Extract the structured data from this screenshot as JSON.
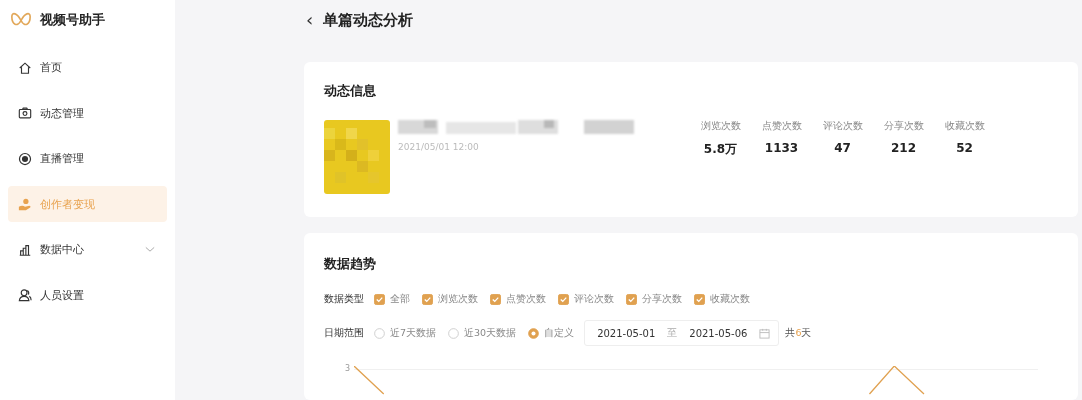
{
  "app": {
    "name": "视频号助手"
  },
  "sidebar": {
    "items": [
      {
        "label": "首页",
        "selected": false,
        "expandable": false
      },
      {
        "label": "动态管理",
        "selected": false,
        "expandable": false
      },
      {
        "label": "直播管理",
        "selected": false,
        "expandable": false
      },
      {
        "label": "创作者变现",
        "selected": true,
        "expandable": false
      },
      {
        "label": "数据中心",
        "selected": false,
        "expandable": true
      },
      {
        "label": "人员设置",
        "selected": false,
        "expandable": false
      }
    ]
  },
  "header": {
    "back": "‹",
    "title": "单篇动态分析"
  },
  "post_info": {
    "title": "动态信息",
    "time": "2021/05/01 12:00",
    "stats": [
      {
        "label": "浏览次数",
        "value": "5.8万"
      },
      {
        "label": "点赞次数",
        "value": "1133"
      },
      {
        "label": "评论次数",
        "value": "47"
      },
      {
        "label": "分享次数",
        "value": "212"
      },
      {
        "label": "收藏次数",
        "value": "52"
      }
    ]
  },
  "trend": {
    "title": "数据趋势",
    "type_label": "数据类型",
    "types": [
      {
        "label": "全部",
        "checked": true
      },
      {
        "label": "浏览次数",
        "checked": true
      },
      {
        "label": "点赞次数",
        "checked": true
      },
      {
        "label": "评论次数",
        "checked": true
      },
      {
        "label": "分享次数",
        "checked": true
      },
      {
        "label": "收藏次数",
        "checked": true
      }
    ],
    "range_label": "日期范围",
    "ranges": [
      {
        "label": "近7天数据",
        "selected": false
      },
      {
        "label": "近30天数据",
        "selected": false
      },
      {
        "label": "自定义",
        "selected": true
      }
    ],
    "start": "2021-05-01",
    "separator": "至",
    "end": "2021-05-06",
    "total": {
      "prefix": "共",
      "days": "6",
      "suffix": "天"
    },
    "y_tick": "3"
  }
}
